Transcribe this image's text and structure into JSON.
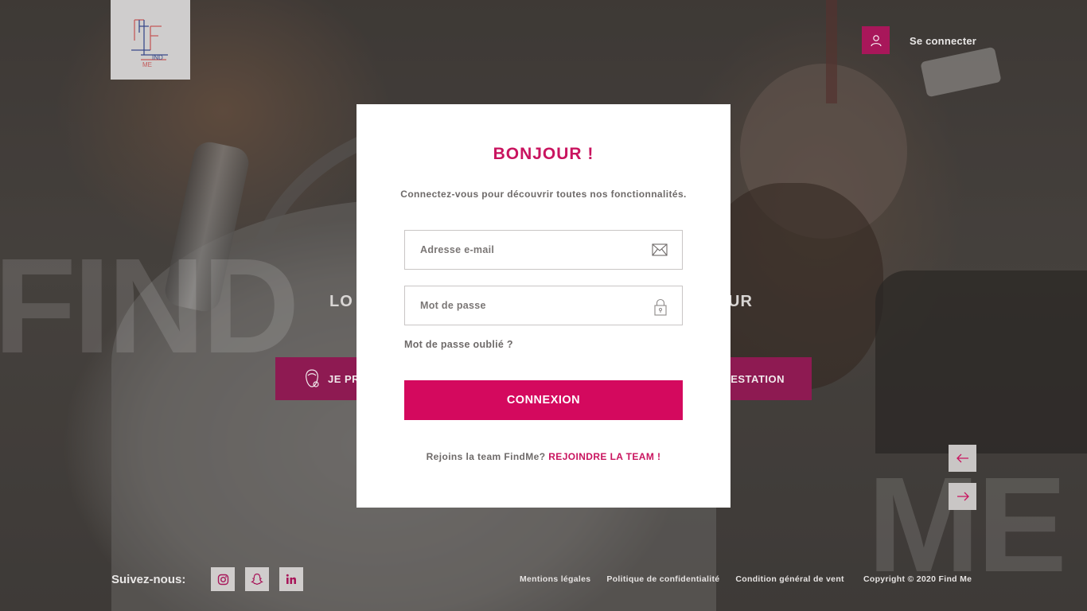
{
  "header": {
    "brand_logo_text": "FIND ME",
    "login_label": "Se connecter"
  },
  "hero": {
    "tagline_left": "LO",
    "tagline_right": "UR",
    "button_left_label": "JE PR",
    "button_right_label": "RESTATION"
  },
  "watermark": {
    "left": "FIND",
    "right": "ME"
  },
  "login_modal": {
    "title": "BONJOUR !",
    "subtitle": "Connectez-vous pour découvrir toutes nos fonctionnalités.",
    "email_placeholder": "Adresse e-mail",
    "password_placeholder": "Mot de passe",
    "forgot_password": "Mot de passe oublié ?",
    "submit_label": "CONNEXION",
    "join_text": "Rejoins la team FindMe?",
    "join_link": "REJOINDRE LA TEAM !"
  },
  "footer": {
    "follow_label": "Suivez-nous:",
    "social": [
      "instagram-icon",
      "snapchat-icon",
      "linkedin-icon"
    ],
    "links": [
      "Mentions légales",
      "Politique de confidentialité",
      "Condition général de vent"
    ],
    "copyright": "Copyright © 2020 Find Me"
  },
  "colors": {
    "accent": "#d4095e",
    "accent_dark": "#a8175a",
    "title": "#c9145f",
    "muted_text": "#6e6a69"
  }
}
